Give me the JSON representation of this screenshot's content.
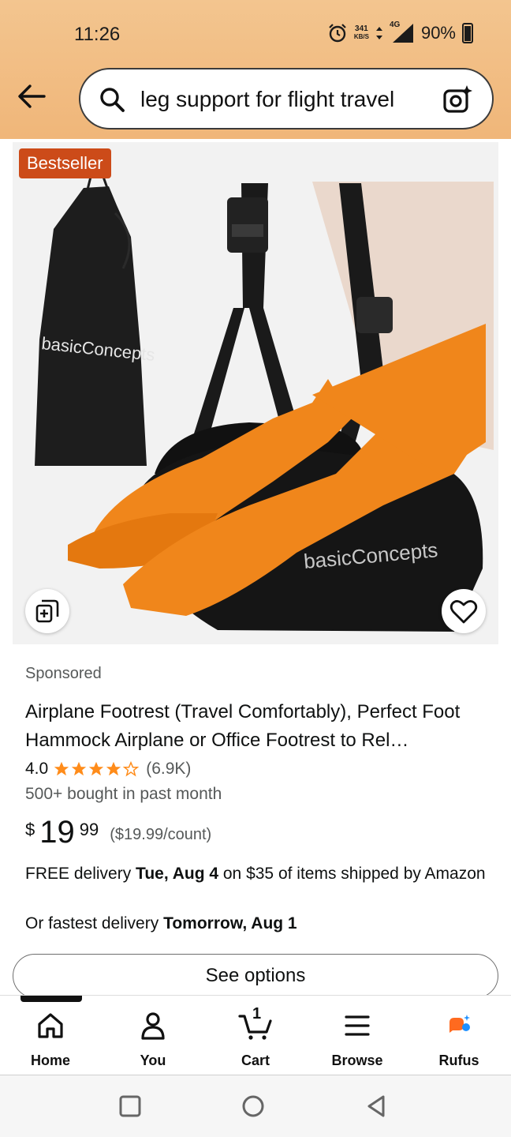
{
  "status_bar": {
    "time": "11:26",
    "speed_value": "341",
    "speed_unit": "KB/S",
    "network": "4G",
    "battery": "90%"
  },
  "search": {
    "query": "leg support for flight travel"
  },
  "product": {
    "badge": "Bestseller",
    "brand_print": "basicConcepts",
    "sponsored": "Sponsored",
    "title": "Airplane Footrest (Travel Comfortably), Perfect Foot Hammock Airplane or Office Footrest to Rel…",
    "rating_value": "4.0",
    "rating_stars": 4,
    "rating_count": "(6.9K)",
    "bought": "500+ bought in past month",
    "price_currency": "$",
    "price_whole": "19",
    "price_fraction": "99",
    "price_unit": "($19.99/count)",
    "delivery_prefix": "FREE delivery ",
    "delivery_date": "Tue, Aug 4",
    "delivery_suffix": " on $35 of items shipped by Amazon",
    "fastest_prefix": "Or fastest delivery ",
    "fastest_date": "Tomorrow, Aug 1",
    "options_button": "See options"
  },
  "bottom_nav": {
    "items": [
      {
        "label": "Home",
        "icon": "home-icon"
      },
      {
        "label": "You",
        "icon": "user-icon"
      },
      {
        "label": "Cart",
        "icon": "cart-icon",
        "badge": "1"
      },
      {
        "label": "Browse",
        "icon": "menu-icon"
      },
      {
        "label": "Rufus",
        "icon": "rufus-icon"
      }
    ]
  },
  "colors": {
    "header": "#f0b679",
    "bestseller": "#cc4b19",
    "star": "#ff8c1a",
    "rufus_orange": "#ff6a1f",
    "rufus_blue": "#1e90ff"
  }
}
